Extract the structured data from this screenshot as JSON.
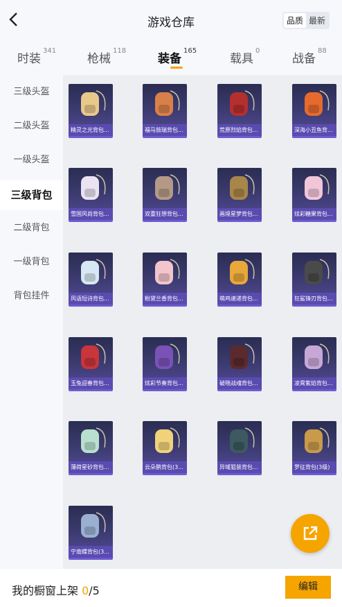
{
  "header": {
    "title": "游戏仓库",
    "sort": [
      "品质",
      "最新"
    ],
    "sort_active": 0
  },
  "tabs": [
    {
      "label": "时装",
      "count": "341"
    },
    {
      "label": "枪械",
      "count": "118"
    },
    {
      "label": "装备",
      "count": "165"
    },
    {
      "label": "载具",
      "count": "0"
    },
    {
      "label": "战备",
      "count": "88"
    }
  ],
  "active_tab": 2,
  "sidebar": [
    "三级头盔",
    "二级头盔",
    "一级头盔",
    "三级背包",
    "二级背包",
    "一级背包",
    "背包挂件"
  ],
  "active_side": 3,
  "items": [
    {
      "name": "精灵之光背包...",
      "color": "#e8c98a"
    },
    {
      "name": "福马鼓瑞背包...",
      "color": "#d9804a"
    },
    {
      "name": "荒原烈焰背包...",
      "color": "#b4302f"
    },
    {
      "name": "深海小丑鱼背...",
      "color": "#e66a2e"
    },
    {
      "name": "雪国风尚背包...",
      "color": "#e9e3f2"
    },
    {
      "name": "双重狂想背包...",
      "color": "#b49a86"
    },
    {
      "name": "画境星梦背包...",
      "color": "#a8864a"
    },
    {
      "name": "炫彩糖果背包...",
      "color": "#f0c6d8"
    },
    {
      "name": "风语短诗背包...",
      "color": "#d8e8f2"
    },
    {
      "name": "粉黛兰香背包...",
      "color": "#f2c4cc"
    },
    {
      "name": "萌鸡速递背包...",
      "color": "#e8a83a"
    },
    {
      "name": "狂鲨锋刃背包...",
      "color": "#4a4a4a"
    },
    {
      "name": "玉兔迎春背包...",
      "color": "#c8353a"
    },
    {
      "name": "炫彩节奏背包...",
      "color": "#7a52b6"
    },
    {
      "name": "破晓战魂背包...",
      "color": "#5a2a2e"
    },
    {
      "name": "凌霄紫焰背包...",
      "color": "#c7a7d6"
    },
    {
      "name": "薄荷星砂背包...",
      "color": "#b9e0cf"
    },
    {
      "name": "云朵鹊背包(3...",
      "color": "#f0d27a"
    },
    {
      "name": "异域狙装背包...",
      "color": "#3c5a60"
    },
    {
      "name": "罗征背包(3级)",
      "color": "#c89a4a"
    },
    {
      "name": "宁南蝶背包(3...",
      "color": "#9ab0d0"
    }
  ],
  "footer": {
    "label": "我的橱窗上架 ",
    "current": "0",
    "sep_total": "/5",
    "edit": "编辑"
  },
  "colors": {
    "accent": "#f5a400",
    "label_bg": "#5a4bb0"
  }
}
